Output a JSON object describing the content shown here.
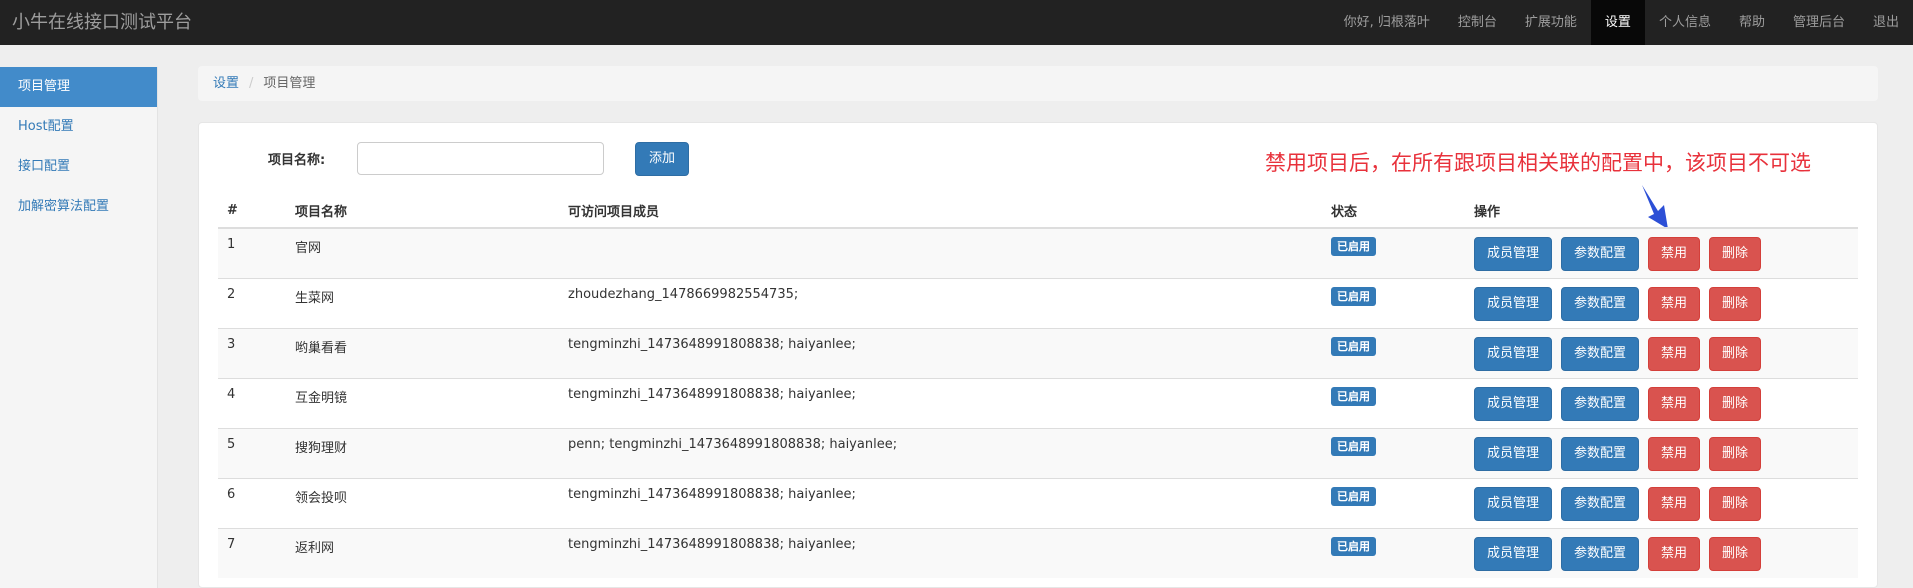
{
  "app": {
    "brand": "小牛在线接口测试平台"
  },
  "topnav": {
    "items": [
      {
        "label": "你好, 归根落叶",
        "active": false
      },
      {
        "label": "控制台",
        "active": false
      },
      {
        "label": "扩展功能",
        "active": false
      },
      {
        "label": "设置",
        "active": true
      },
      {
        "label": "个人信息",
        "active": false
      },
      {
        "label": "帮助",
        "active": false
      },
      {
        "label": "管理后台",
        "active": false
      },
      {
        "label": "退出",
        "active": false
      }
    ]
  },
  "sidebar": {
    "items": [
      {
        "label": "项目管理",
        "active": true
      },
      {
        "label": "Host配置",
        "active": false
      },
      {
        "label": "接口配置",
        "active": false
      },
      {
        "label": "加解密算法配置",
        "active": false
      }
    ]
  },
  "breadcrumb": {
    "parent": "设置",
    "separator": "/",
    "current": "项目管理"
  },
  "form": {
    "label": "项目名称:",
    "value": "",
    "placeholder": "",
    "add_label": "添加"
  },
  "annotation": {
    "text": "禁用项目后，在所有跟项目相关联的配置中，该项目不可选",
    "color": "#e8313b"
  },
  "table": {
    "headers": [
      "#",
      "项目名称",
      "可访问项目成员",
      "状态",
      "操作"
    ],
    "actions": {
      "members": "成员管理",
      "params": "参数配置",
      "disable": "禁用",
      "delete": "删除"
    },
    "rows": [
      {
        "num": "1",
        "name": "官网",
        "members": "",
        "status": "已启用"
      },
      {
        "num": "2",
        "name": "生菜网",
        "members": "zhoudezhang_1478669982554735;",
        "status": "已启用"
      },
      {
        "num": "3",
        "name": "哟巢看看",
        "members": "tengminzhi_1473648991808838; haiyanlee;",
        "status": "已启用"
      },
      {
        "num": "4",
        "name": "互金明镜",
        "members": "tengminzhi_1473648991808838; haiyanlee;",
        "status": "已启用"
      },
      {
        "num": "5",
        "name": "搜狗理财",
        "members": "penn; tengminzhi_1473648991808838; haiyanlee;",
        "status": "已启用"
      },
      {
        "num": "6",
        "name": "领会投呗",
        "members": "tengminzhi_1473648991808838; haiyanlee;",
        "status": "已启用"
      },
      {
        "num": "7",
        "name": "返利网",
        "members": "tengminzhi_1473648991808838; haiyanlee;",
        "status": "已启用"
      }
    ]
  },
  "colors": {
    "navbar": "#222222",
    "primary": "#337ab7",
    "danger": "#d9534f",
    "sidebar_active": "#428bca"
  }
}
